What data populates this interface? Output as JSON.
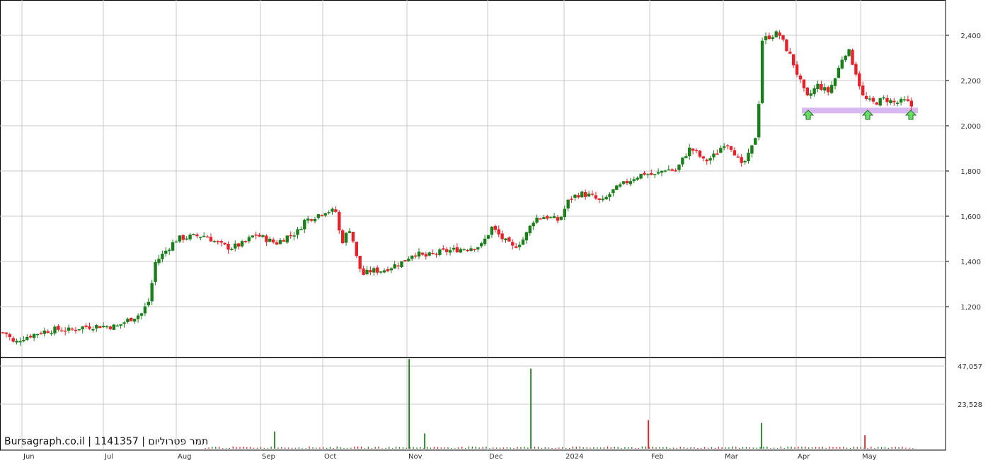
{
  "caption": {
    "site": "Bursagraph.co.il",
    "security_id": "1141357",
    "name": "תמר פטרוליום",
    "separator": " | "
  },
  "colors": {
    "up": "#1a7f1a",
    "down": "#e8202a",
    "grid": "#c8c8c8",
    "support_band": "#d8b8f0",
    "arrow": "#66e066"
  },
  "chart_data": [
    {
      "type": "candlestick",
      "title": "",
      "x_axis_months": [
        "Jun",
        "Jul",
        "Aug",
        "Sep",
        "Oct",
        "Nov",
        "Dec",
        "2024",
        "Feb",
        "Mar",
        "Apr",
        "May"
      ],
      "y_axis_ticks": [
        "1,200",
        "1,400",
        "1,600",
        "1,800",
        "2,000",
        "2,200",
        "2,400"
      ],
      "y_tick_values": [
        1200,
        1400,
        1600,
        1800,
        2000,
        2200,
        2400
      ],
      "ylim": [
        1000,
        2530
      ],
      "grid": true,
      "support_zone": [
        2055,
        2080
      ],
      "support_markers_months_index": [
        10,
        11,
        11
      ],
      "price_path": [
        [
          0,
          1090
        ],
        [
          10,
          1080
        ],
        [
          20,
          1035
        ],
        [
          30,
          1060
        ],
        [
          45,
          1075
        ],
        [
          60,
          1090
        ],
        [
          80,
          1100
        ],
        [
          100,
          1095
        ],
        [
          115,
          1110
        ],
        [
          140,
          1115
        ],
        [
          165,
          1112
        ],
        [
          180,
          1140
        ],
        [
          200,
          1170
        ],
        [
          212,
          1235
        ],
        [
          218,
          1390
        ],
        [
          235,
          1450
        ],
        [
          250,
          1500
        ],
        [
          270,
          1510
        ],
        [
          290,
          1515
        ],
        [
          310,
          1475
        ],
        [
          325,
          1460
        ],
        [
          345,
          1480
        ],
        [
          360,
          1520
        ],
        [
          375,
          1500
        ],
        [
          390,
          1480
        ],
        [
          405,
          1510
        ],
        [
          420,
          1530
        ],
        [
          430,
          1580
        ],
        [
          445,
          1600
        ],
        [
          460,
          1625
        ],
        [
          475,
          1620
        ],
        [
          482,
          1480
        ],
        [
          495,
          1550
        ],
        [
          505,
          1400
        ],
        [
          512,
          1340
        ],
        [
          525,
          1360
        ],
        [
          540,
          1360
        ],
        [
          555,
          1380
        ],
        [
          570,
          1400
        ],
        [
          585,
          1440
        ],
        [
          600,
          1420
        ],
        [
          620,
          1440
        ],
        [
          640,
          1450
        ],
        [
          660,
          1460
        ],
        [
          680,
          1470
        ],
        [
          695,
          1550
        ],
        [
          710,
          1500
        ],
        [
          725,
          1460
        ],
        [
          740,
          1500
        ],
        [
          755,
          1590
        ],
        [
          770,
          1600
        ],
        [
          790,
          1580
        ],
        [
          805,
          1680
        ],
        [
          820,
          1700
        ],
        [
          835,
          1690
        ],
        [
          850,
          1660
        ],
        [
          865,
          1710
        ],
        [
          880,
          1740
        ],
        [
          895,
          1770
        ],
        [
          910,
          1790
        ],
        [
          925,
          1780
        ],
        [
          940,
          1810
        ],
        [
          955,
          1800
        ],
        [
          968,
          1870
        ],
        [
          975,
          1900
        ],
        [
          985,
          1880
        ],
        [
          995,
          1840
        ],
        [
          1010,
          1870
        ],
        [
          1025,
          1930
        ],
        [
          1035,
          1900
        ],
        [
          1048,
          1820
        ],
        [
          1060,
          1880
        ],
        [
          1070,
          1980
        ],
        [
          1077,
          2380
        ],
        [
          1090,
          2400
        ],
        [
          1100,
          2410
        ],
        [
          1108,
          2360
        ],
        [
          1118,
          2300
        ],
        [
          1130,
          2200
        ],
        [
          1140,
          2120
        ],
        [
          1155,
          2180
        ],
        [
          1170,
          2150
        ],
        [
          1180,
          2210
        ],
        [
          1190,
          2300
        ],
        [
          1198,
          2340
        ],
        [
          1210,
          2230
        ],
        [
          1220,
          2120
        ],
        [
          1235,
          2100
        ],
        [
          1250,
          2120
        ],
        [
          1265,
          2100
        ],
        [
          1280,
          2110
        ],
        [
          1290,
          2080
        ]
      ]
    },
    {
      "type": "bar",
      "title": "",
      "y_axis_ticks": [
        "47,057",
        "23,528"
      ],
      "ylim": [
        0,
        47057
      ],
      "spikes": [
        {
          "x": 388,
          "value": 9000
        },
        {
          "x": 578,
          "value": 47000
        },
        {
          "x": 600,
          "value": 8000
        },
        {
          "x": 750,
          "value": 42000
        },
        {
          "x": 916,
          "value": 15000
        },
        {
          "x": 1076,
          "value": 13500
        },
        {
          "x": 1222,
          "value": 7000
        }
      ]
    }
  ]
}
